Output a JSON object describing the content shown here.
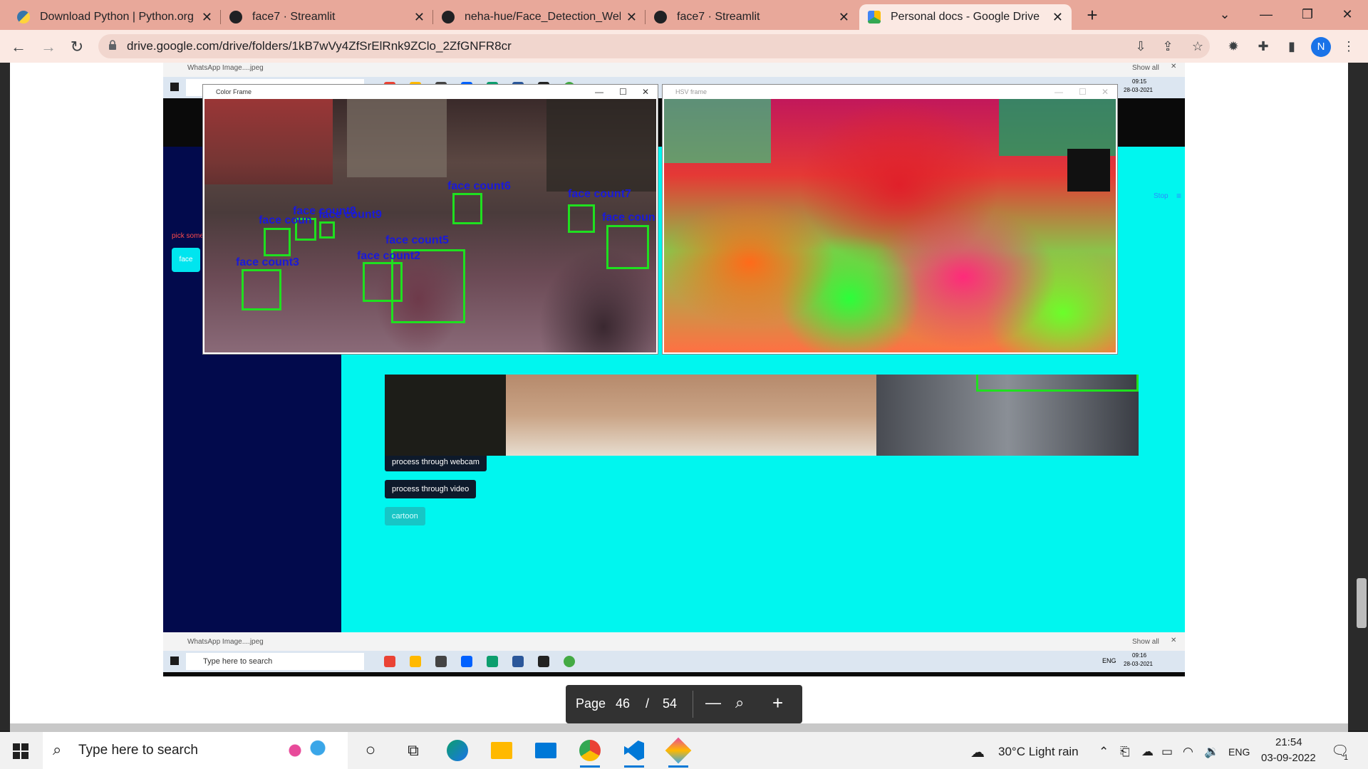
{
  "browser": {
    "tabs": [
      {
        "title": "Download Python | Python.org",
        "favicon_color": "#3776ab",
        "active": false
      },
      {
        "title": "face7 · Streamlit",
        "favicon_color": "#202124",
        "active": false
      },
      {
        "title": "neha-hue/Face_Detection_WebA",
        "favicon_color": "#202124",
        "active": false
      },
      {
        "title": "face7 · Streamlit",
        "favicon_color": "#202124",
        "active": false
      },
      {
        "title": "Personal docs - Google Drive",
        "favicon_color": "#fbbc04",
        "active": true
      }
    ],
    "url": "drive.google.com/drive/folders/1kB7wVy4ZfSrElRnk9ZClo_2ZfGNFR8cr",
    "profile_initial": "N"
  },
  "pdf": {
    "page_label": "Page",
    "current_page": "46",
    "separator": "/",
    "total_pages": "54"
  },
  "embedded": {
    "download_file": "WhatsApp Image....jpeg",
    "show_all": "Show all",
    "mini_search_placeholder": "Type here to search",
    "mini_lang": "ENG",
    "mini_time_top": "09:15",
    "mini_date_top": "28-03-2021",
    "mini_time_bottom": "09:16",
    "mini_date_bottom": "28-03-2021",
    "color_window_title": "Color Frame",
    "hsv_window_title": "HSV frame",
    "sidebar_text": "pick some",
    "sidebar_button": "face",
    "stop_label": "Stop",
    "buttons": {
      "webcam": "process through webcam",
      "video": "process through video",
      "cartoon": "cartoon"
    },
    "face_labels": [
      "face count6",
      "face count7",
      "face count8",
      "face count9",
      "face coun",
      "face count5",
      "face count2",
      "face count3",
      "face coun"
    ]
  },
  "taskbar": {
    "search_placeholder": "Type here to search",
    "weather": "30°C  Light rain",
    "lang": "ENG",
    "time": "21:54",
    "date": "03-09-2022",
    "notification_count": "1"
  }
}
